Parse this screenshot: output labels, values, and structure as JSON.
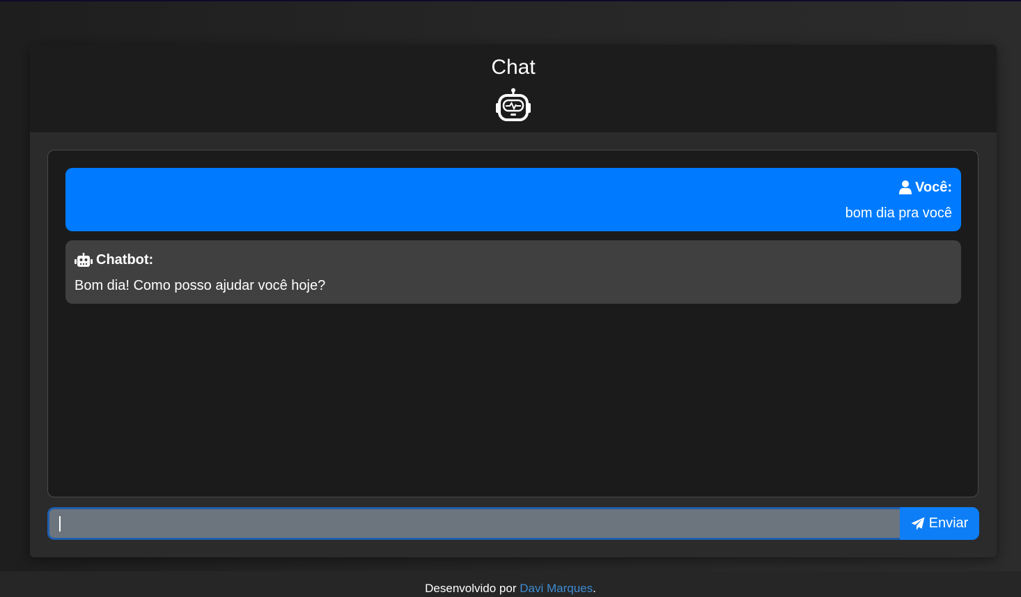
{
  "header": {
    "title": "Chat",
    "icon": "robot-icon"
  },
  "messages": [
    {
      "role": "user",
      "icon": "user-icon",
      "sender": "Você:",
      "text": "bom dia pra você",
      "color": "#007bff"
    },
    {
      "role": "bot",
      "icon": "robot-icon",
      "sender": "Chatbot:",
      "text": "Bom dia! Como posso ajudar você hoje?",
      "color": "#404040"
    }
  ],
  "composer": {
    "value": "",
    "send_label": "Enviar",
    "send_icon": "paper-plane-icon",
    "accent": "#0d7ef6"
  },
  "footer": {
    "prefix": "Desenvolvido por",
    "author": "Davi Marques",
    "suffix": ".",
    "link_color": "#3d8bd3"
  }
}
